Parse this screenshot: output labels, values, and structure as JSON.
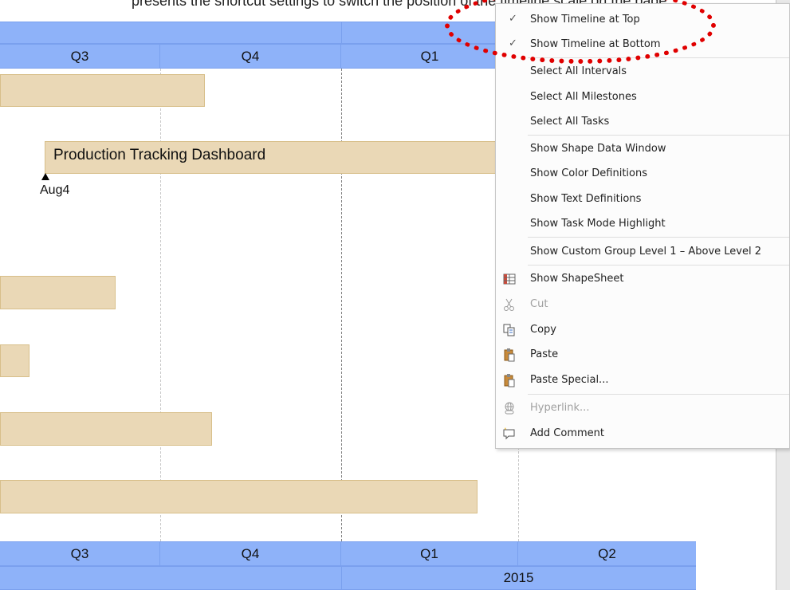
{
  "header_text": "presents the shortcut settings to switch the position of the timeline scale on the page",
  "timeline": {
    "top_quarters": [
      "Q3",
      "Q4",
      "Q1"
    ],
    "bottom_quarters": [
      "Q3",
      "Q4",
      "Q1",
      "Q2"
    ],
    "bottom_year": "2015",
    "band_color": "#8eb2f9"
  },
  "tasks": {
    "main_label": "Production Tracking Dashboard",
    "bar_color": "#ead8b6"
  },
  "milestone": {
    "label": "Aug4"
  },
  "context_menu": {
    "items": [
      {
        "label": "Show Timeline at Top",
        "checked": "✓"
      },
      {
        "label": "Show Timeline at Bottom",
        "checked": "✓"
      },
      {
        "label": "Select All Intervals"
      },
      {
        "label": "Select All Milestones"
      },
      {
        "label": "Select All Tasks"
      },
      {
        "label": "Show Shape Data Window"
      },
      {
        "label": "Show Color Definitions"
      },
      {
        "label": "Show Text Definitions"
      },
      {
        "label": "Show Task Mode Highlight"
      },
      {
        "label": "Show Custom Group Level 1 – Above Level 2"
      },
      {
        "label": "Show ShapeSheet",
        "icon": "shapesheet-icon"
      },
      {
        "label": "Cut",
        "icon": "scissors-icon",
        "disabled": true
      },
      {
        "label": "Copy",
        "icon": "copy-icon"
      },
      {
        "label": "Paste",
        "icon": "paste-icon"
      },
      {
        "label": "Paste Special...",
        "icon": "paste-special-icon"
      },
      {
        "label": "Hyperlink...",
        "icon": "hyperlink-icon",
        "disabled": true
      },
      {
        "label": "Add Comment",
        "icon": "comment-icon"
      }
    ]
  },
  "annotation_color": "#e00000"
}
